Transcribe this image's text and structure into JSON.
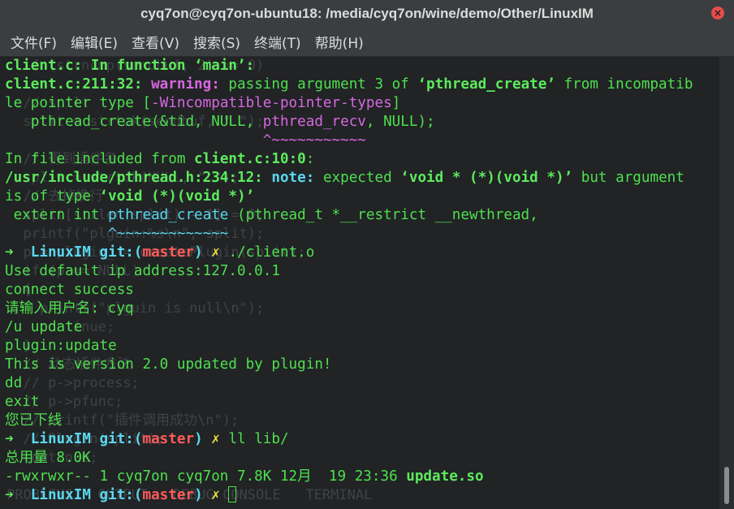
{
  "window": {
    "title": "cyq7on@cyq7on-ubuntu18: /media/cyq7on/wine/demo/Other/LinuxIM",
    "close_glyph": "×"
  },
  "menu": [
    "文件(F)",
    "编辑(E)",
    "查看(V)",
    "搜索(S)",
    "终端(T)",
    "帮助(H)"
  ],
  "ghost_lines": [
    "  if (strncmp(sendbuf, 2) == 0)",
    "",
    "  // spilt",
    "  split = strtok(sendbuf, \" \");",
    "",
    "  // 得到插件名",
    "  split = strtok(NULL, \" \");",
    "  // 去掉换行",
    "  split[strlen(split) - 1] = 0;",
    "  printf(\"plguin:%s\\n\", split);",
    "  p = plugin_ = createPlugin(split);",
    "  if (p == NULL)",
    "  {",
    "    printf(\"plguin is null\\n\");",
    "    continue;",
    "  }",
    "  // 动态插件方法",
    "  // p->process;",
    "  // p->pfunc;",
    "  // printf(\"插件调用成功\\n\");",
    "  // Plugin(split);",
    "  continue;",
    "",
    "PROBLEMS   OUTPUT   DEBUG CONSOLE   TERMINAL"
  ],
  "lines": [
    [
      {
        "t": "client.c:",
        "s": "c-bold"
      },
      {
        "t": " In function ",
        "s": "c-bold"
      },
      {
        "t": "‘main’",
        "s": "c-bold"
      },
      {
        "t": ":",
        "s": "c-bold"
      }
    ],
    [
      {
        "t": "client.c:211:32: ",
        "s": "c-bold"
      },
      {
        "t": "warning: ",
        "s": "c-warn"
      },
      {
        "t": "passing argument 3 of ",
        "s": ""
      },
      {
        "t": "‘pthread_create’",
        "s": "c-bold"
      },
      {
        "t": " from incompatib",
        "s": ""
      }
    ],
    [
      {
        "t": "le pointer type [",
        "s": ""
      },
      {
        "t": "-Wincompatible-pointer-types",
        "s": "c-magenta"
      },
      {
        "t": "]",
        "s": ""
      }
    ],
    [
      {
        "t": "   pthread_create(&tid, NULL, ",
        "s": ""
      },
      {
        "t": "pthread_recv",
        "s": "c-magenta"
      },
      {
        "t": ", NULL);",
        "s": ""
      }
    ],
    [
      {
        "t": "                              ^~~~~~~~~~~~",
        "s": "c-magenta"
      }
    ],
    [
      {
        "t": "In file included from ",
        "s": ""
      },
      {
        "t": "client.c:10:0",
        "s": "c-bold"
      },
      {
        "t": ":",
        "s": ""
      }
    ],
    [
      {
        "t": "/usr/include/pthread.h:234:12: ",
        "s": "c-bold"
      },
      {
        "t": "note: ",
        "s": "c-note"
      },
      {
        "t": "expected ",
        "s": ""
      },
      {
        "t": "‘void * (*)(void *)’",
        "s": "c-bold"
      },
      {
        "t": " but argument",
        "s": ""
      }
    ],
    [
      {
        "t": "is of type ",
        "s": ""
      },
      {
        "t": "‘void (*)(void *)’",
        "s": "c-bold"
      }
    ],
    [
      {
        "t": " extern int ",
        "s": ""
      },
      {
        "t": "pthread_create",
        "s": "c-cyan"
      },
      {
        "t": " (pthread_t *__restrict __newthread,",
        "s": ""
      }
    ],
    [
      {
        "t": "            ^~~~~~~~~~~~~~",
        "s": "c-cyan"
      }
    ],
    [
      {
        "t": "➜  ",
        "s": "c-bold"
      },
      {
        "t": "LinuxIM ",
        "s": "c-note"
      },
      {
        "t": "git:(",
        "s": "c-note"
      },
      {
        "t": "master",
        "s": "c-red b"
      },
      {
        "t": ") ",
        "s": "c-note"
      },
      {
        "t": "✗ ",
        "s": "c-yellow b"
      },
      {
        "t": "./client.o",
        "s": ""
      }
    ],
    [
      {
        "t": "Use default ip address:127.0.0.1",
        "s": ""
      }
    ],
    [
      {
        "t": "connect success",
        "s": ""
      }
    ],
    [
      {
        "t": "请输入用户名: cyq",
        "s": ""
      }
    ],
    [
      {
        "t": "/u update",
        "s": ""
      }
    ],
    [
      {
        "t": "plugin:update",
        "s": ""
      }
    ],
    [
      {
        "t": "This is version 2.0 updated by plugin!",
        "s": ""
      }
    ],
    [
      {
        "t": "dd",
        "s": ""
      }
    ],
    [
      {
        "t": "exit",
        "s": ""
      }
    ],
    [
      {
        "t": "您已下线",
        "s": ""
      }
    ],
    [
      {
        "t": "➜  ",
        "s": "c-bold"
      },
      {
        "t": "LinuxIM ",
        "s": "c-note"
      },
      {
        "t": "git:(",
        "s": "c-note"
      },
      {
        "t": "master",
        "s": "c-red b"
      },
      {
        "t": ") ",
        "s": "c-note"
      },
      {
        "t": "✗ ",
        "s": "c-yellow b"
      },
      {
        "t": "ll lib/",
        "s": ""
      }
    ],
    [
      {
        "t": "总用量 8.0K",
        "s": ""
      }
    ],
    [
      {
        "t": "-rwxrwxr-- 1 cyq7on cyq7on 7.8K 12月  19 23:36 ",
        "s": ""
      },
      {
        "t": "update.so",
        "s": "c-bold"
      }
    ],
    [
      {
        "t": "➜  ",
        "s": "c-bold"
      },
      {
        "t": "LinuxIM ",
        "s": "c-note"
      },
      {
        "t": "git:(",
        "s": "c-note"
      },
      {
        "t": "master",
        "s": "c-red b"
      },
      {
        "t": ") ",
        "s": "c-note"
      },
      {
        "t": "✗ ",
        "s": "c-yellow b"
      }
    ]
  ],
  "colors": {
    "background": "#212325",
    "foreground": "#4ee04e",
    "warning": "#d768e0",
    "note": "#5ad8ee",
    "branch": "#ff5b5b",
    "dirty": "#e8e23c"
  }
}
